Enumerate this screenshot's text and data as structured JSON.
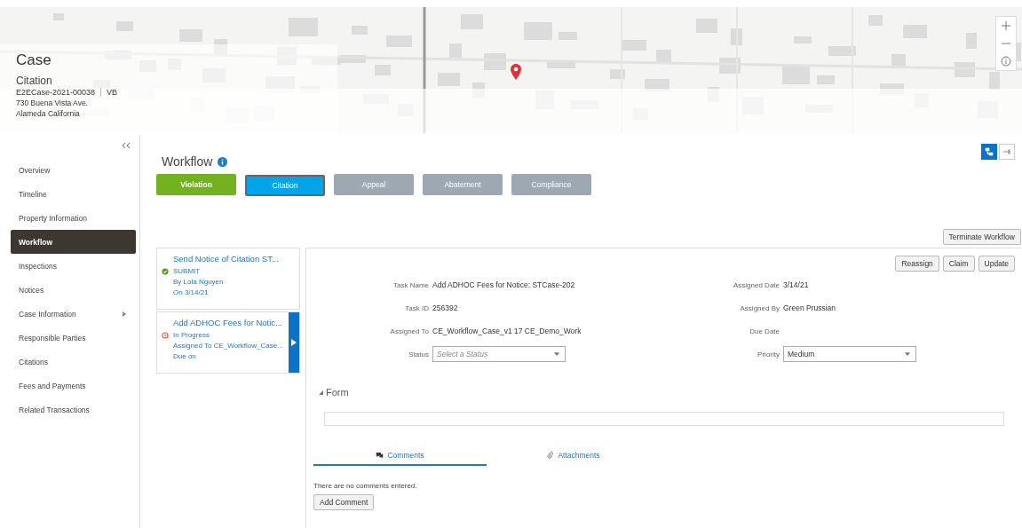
{
  "case": {
    "heading": "Case",
    "type": "Citation",
    "number": "E2ECase-2021-00038",
    "initials": "VB",
    "address_line1": "730 Buena Vista Ave.",
    "address_line2": "Alameda California"
  },
  "view_toggles": [
    {
      "kind": "hierarchy",
      "selected": true
    },
    {
      "kind": "flow",
      "selected": false
    }
  ],
  "sidebar": {
    "items": [
      {
        "label": "Overview",
        "selected": false,
        "expandable": false
      },
      {
        "label": "Timeline",
        "selected": false,
        "expandable": false
      },
      {
        "label": "Property Information",
        "selected": false,
        "expandable": false
      },
      {
        "label": "Workflow",
        "selected": true,
        "expandable": false
      },
      {
        "label": "Inspections",
        "selected": false,
        "expandable": false
      },
      {
        "label": "Notices",
        "selected": false,
        "expandable": false
      },
      {
        "label": "Case Information",
        "selected": false,
        "expandable": true
      },
      {
        "label": "Responsible Parties",
        "selected": false,
        "expandable": false
      },
      {
        "label": "Citations",
        "selected": false,
        "expandable": false
      },
      {
        "label": "Fees and Payments",
        "selected": false,
        "expandable": false
      },
      {
        "label": "Related Transactions",
        "selected": false,
        "expandable": false
      }
    ]
  },
  "workflow": {
    "title": "Workflow",
    "stages": [
      {
        "label": "Violation",
        "kind": "complete",
        "selected": false
      },
      {
        "label": "Citation",
        "kind": "current",
        "selected": true
      },
      {
        "label": "Appeal",
        "kind": "pending",
        "selected": false
      },
      {
        "label": "Abatement",
        "kind": "pending",
        "selected": false
      },
      {
        "label": "Compliance",
        "kind": "pending",
        "selected": false
      }
    ],
    "terminate_button": "Terminate Workflow"
  },
  "tasks": [
    {
      "title": "Send Notice of Citation ST...",
      "kind": "complete",
      "status": "SUBMIT",
      "line2": "By Lola Nguyen",
      "line3": "On 3/14/21",
      "selected": false
    },
    {
      "title": "Add ADHOC Fees for Notic...",
      "kind": "in_progress",
      "status": "In Progress",
      "line2": "Assigned To CE_Workflow_Case...",
      "line3": "Due on",
      "selected": true
    }
  ],
  "task_detail": {
    "actions": [
      "Reassign",
      "Claim",
      "Update"
    ],
    "left_fields": [
      {
        "label": "Task Name",
        "kind": "text",
        "value": "Add ADHOC Fees for Notice: STCase-202"
      },
      {
        "label": "Task ID",
        "kind": "text",
        "value": "256392"
      },
      {
        "label": "Assigned To",
        "kind": "text",
        "value": "CE_Workflow_Case_v1 17 CE_Demo_Work"
      },
      {
        "label": "Status",
        "kind": "select",
        "placeholder": "Select a Status"
      }
    ],
    "right_fields": [
      {
        "label": "Assigned Date",
        "kind": "text",
        "value": "3/14/21"
      },
      {
        "label": "Assigned By",
        "kind": "text",
        "value": "Green Prussian"
      },
      {
        "label": "Due Date",
        "kind": "text"
      },
      {
        "label": "Priority",
        "kind": "select",
        "value": "Medium"
      }
    ],
    "form_section": {
      "title": "Form",
      "expanded": true
    },
    "tabs": [
      {
        "label": "Comments",
        "kind": "comments",
        "selected": true
      },
      {
        "label": "Attachments",
        "kind": "attachments",
        "selected": false
      }
    ],
    "empty_message": "There are no comments entered.",
    "add_button": "Add Comment"
  }
}
